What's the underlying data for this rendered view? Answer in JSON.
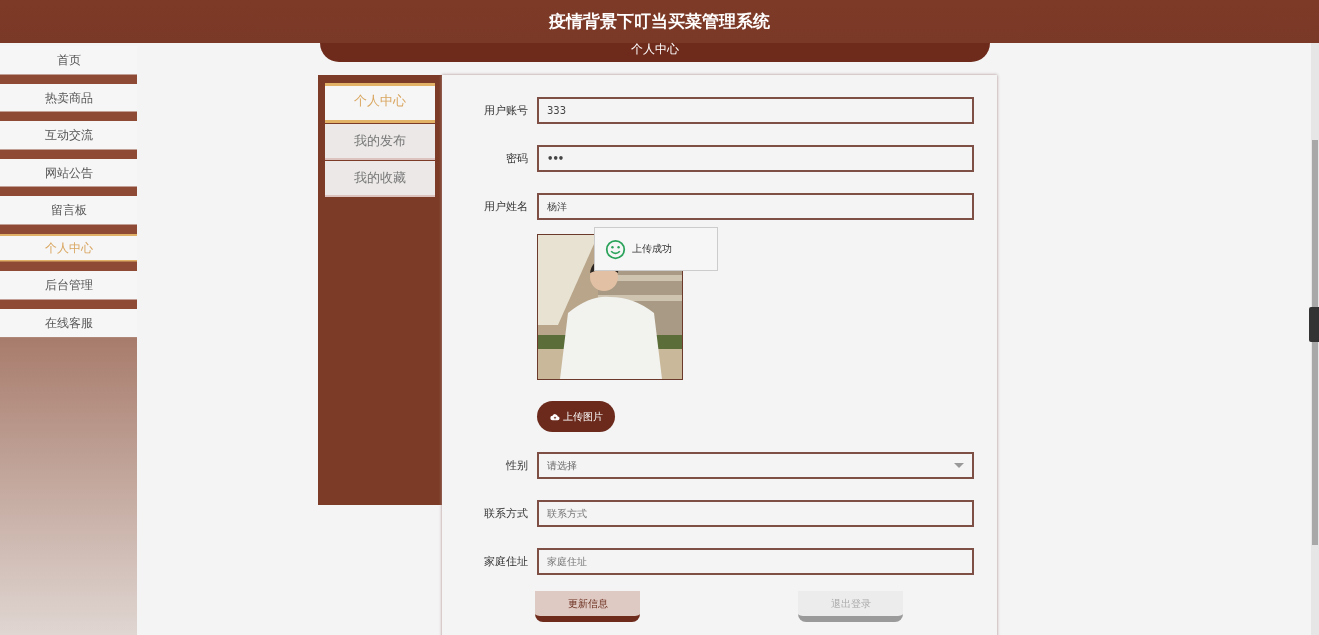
{
  "header": {
    "title": "疫情背景下叮当买菜管理系统",
    "subtitle": "个人中心"
  },
  "nav": [
    {
      "label": "首页",
      "selected": false
    },
    {
      "label": "热卖商品",
      "selected": false
    },
    {
      "label": "互动交流",
      "selected": false
    },
    {
      "label": "网站公告",
      "selected": false
    },
    {
      "label": "留言板",
      "selected": false
    },
    {
      "label": "个人中心",
      "selected": true
    },
    {
      "label": "后台管理",
      "selected": false
    },
    {
      "label": "在线客服",
      "selected": false
    }
  ],
  "tabs": [
    {
      "label": "个人中心",
      "selected": true
    },
    {
      "label": "我的发布",
      "selected": false
    },
    {
      "label": "我的收藏",
      "selected": false
    }
  ],
  "form": {
    "fields": [
      {
        "kind": "text",
        "label": "用户账号",
        "value": "333"
      },
      {
        "kind": "password",
        "label": "密码",
        "value": "•••"
      },
      {
        "kind": "text",
        "label": "用户姓名",
        "value": "杨洋"
      },
      {
        "button": "上传图片"
      },
      {
        "kind": "select",
        "label": "性别",
        "placeholder": "请选择"
      },
      {
        "kind": "text",
        "label": "联系方式",
        "placeholder": "联系方式"
      },
      {
        "kind": "text",
        "label": "家庭住址",
        "placeholder": "家庭住址"
      }
    ],
    "buttons": [
      {
        "label": "更新信息",
        "kind": "primary"
      },
      {
        "label": "退出登录",
        "kind": "secondary"
      }
    ]
  },
  "toast": {
    "text": "上传成功"
  }
}
